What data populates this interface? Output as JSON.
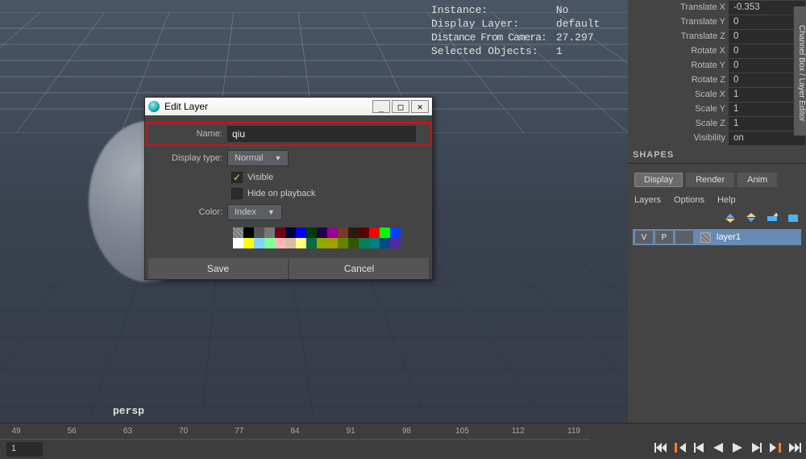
{
  "hud": [
    {
      "label": "Instance:",
      "value": "No"
    },
    {
      "label": "Display Layer:",
      "value": "default"
    },
    {
      "label": "Distance From Camera:",
      "value": "27.297"
    },
    {
      "label": "Selected Objects:",
      "value": "1"
    }
  ],
  "channel_rows": [
    {
      "label": "Translate X",
      "value": "-0.353"
    },
    {
      "label": "Translate Y",
      "value": "0"
    },
    {
      "label": "Translate Z",
      "value": "0"
    },
    {
      "label": "Rotate X",
      "value": "0"
    },
    {
      "label": "Rotate Y",
      "value": "0"
    },
    {
      "label": "Rotate Z",
      "value": "0"
    },
    {
      "label": "Scale X",
      "value": "1"
    },
    {
      "label": "Scale Y",
      "value": "1"
    },
    {
      "label": "Scale Z",
      "value": "1"
    },
    {
      "label": "Visibility",
      "value": "on"
    }
  ],
  "channel_section": "SHAPES",
  "layer_tabs": [
    {
      "label": "Display",
      "active": true
    },
    {
      "label": "Render",
      "active": false
    },
    {
      "label": "Anim",
      "active": false
    }
  ],
  "layer_menus": [
    "Layers",
    "Options",
    "Help"
  ],
  "layer_row": {
    "vis": "V",
    "play": "P",
    "name": "layer1"
  },
  "side_tab": "Channel Box / Layer Editor",
  "dialog": {
    "title": "Edit Layer",
    "name_label": "Name:",
    "name_value": "qiu",
    "display_type_label": "Display type:",
    "display_type_value": "Normal",
    "visible_label": "Visible",
    "hide_on_playback_label": "Hide on playback",
    "color_label": "Color:",
    "color_value": "Index",
    "save": "Save",
    "cancel": "Cancel"
  },
  "swatches": [
    "#000000",
    "#555555",
    "#777777",
    "#720014",
    "#00003a",
    "#0000ff",
    "#003b00",
    "#21004a",
    "#990099",
    "#763b26",
    "#2a1b11",
    "#5a0000",
    "#ff0000",
    "#00ff00",
    "#0040ff",
    "#ffffff",
    "#ffff00",
    "#7fd6ff",
    "#7dff9e",
    "#ffb6b6",
    "#d9bda0",
    "#ffff80",
    "#0a6a45",
    "#8fa800",
    "#a0a000",
    "#668000",
    "#2e5900",
    "#008054",
    "#008080",
    "#004c8a",
    "#4f2aa0"
  ],
  "timeline": {
    "ticks": [
      "49",
      "56",
      "63",
      "70",
      "77",
      "84",
      "91",
      "98",
      "105",
      "112",
      "119"
    ],
    "current": "1"
  },
  "viewport_label": "persp"
}
